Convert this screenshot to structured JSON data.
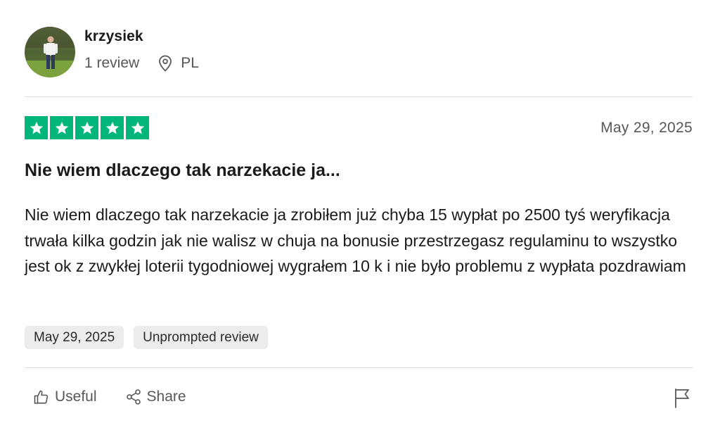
{
  "reviewer": {
    "name": "krzysiek",
    "review_count": "1 review",
    "country": "PL",
    "avatar_icon": "user-photo-avatar"
  },
  "review": {
    "rating_stars": 5,
    "rating_max": 5,
    "star_color": "#00b67a",
    "date": "May 29, 2025",
    "title": "Nie wiem dlaczego tak narzekacie ja...",
    "body": "Nie wiem dlaczego tak narzekacie ja zrobiłem już chyba 15 wypłat po 2500 tyś weryfikacja trwała kilka godzin jak nie walisz w chuja na bonusie przestrzegasz regulaminu to wszystko jest ok z zwykłej loterii tygodniowej wygrałem 10 k i nie było problemu z wypłata pozdrawiam",
    "tags": [
      "May 29, 2025",
      "Unprompted review"
    ]
  },
  "actions": {
    "useful_label": "Useful",
    "share_label": "Share",
    "useful_icon": "thumbs-up-icon",
    "share_icon": "share-icon",
    "flag_icon": "flag-icon"
  }
}
